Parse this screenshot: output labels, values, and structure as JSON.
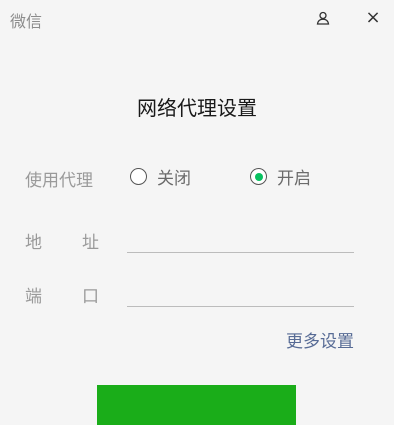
{
  "app": {
    "title": "微信"
  },
  "titlebar": {
    "user_icon": "user-icon",
    "close_icon": "close-icon",
    "close_glyph": "×"
  },
  "dialog": {
    "title": "网络代理设置"
  },
  "proxy": {
    "label": "使用代理",
    "options": [
      {
        "label": "关闭",
        "selected": false
      },
      {
        "label": "开启",
        "selected": true
      }
    ]
  },
  "address": {
    "label_chars": [
      "地",
      "址"
    ],
    "value": ""
  },
  "port": {
    "label_chars": [
      "端",
      "口"
    ],
    "value": ""
  },
  "more_settings": {
    "label": "更多设置"
  },
  "colors": {
    "accent_green": "#07c160",
    "button_green": "#1aad19",
    "link_blue": "#576b95"
  }
}
